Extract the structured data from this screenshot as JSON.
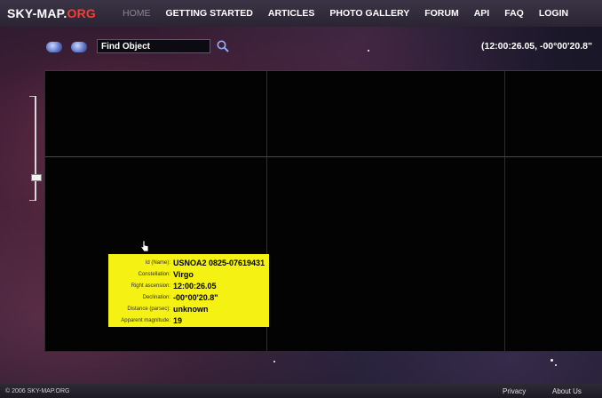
{
  "logo": {
    "main": "SKY-MAP.",
    "accent": "ORG"
  },
  "nav": {
    "items": [
      {
        "label": "HOME",
        "active": true
      },
      {
        "label": "GETTING STARTED"
      },
      {
        "label": "ARTICLES"
      },
      {
        "label": "PHOTO GALLERY"
      },
      {
        "label": "FORUM"
      },
      {
        "label": "API"
      },
      {
        "label": "FAQ"
      },
      {
        "label": "LOGIN"
      }
    ]
  },
  "search": {
    "value": "Find Object",
    "icon": "search-icon"
  },
  "coords": "(12:00:26.05, -00°00'20.8\"",
  "info": {
    "rows": [
      {
        "key": "Id (Name):",
        "value": "USNOA2 0825-07619431"
      },
      {
        "key": "Constellation:",
        "value": "Virgo"
      },
      {
        "key": "Right ascension:",
        "value": "12:00:26.05"
      },
      {
        "key": "Declination:",
        "value": "-00°00'20.8\""
      },
      {
        "key": "Distance (parsec):",
        "value": "unknown"
      },
      {
        "key": "Apparent magnitude:",
        "value": "19"
      }
    ]
  },
  "footer": {
    "copyright": "© 2006 SKY-MAP.ORG",
    "privacy": "Privacy",
    "about": "About Us"
  },
  "colors": {
    "accent": "#ff3b2f",
    "info_bg": "#f4f113",
    "sky_bg": "#030303"
  }
}
